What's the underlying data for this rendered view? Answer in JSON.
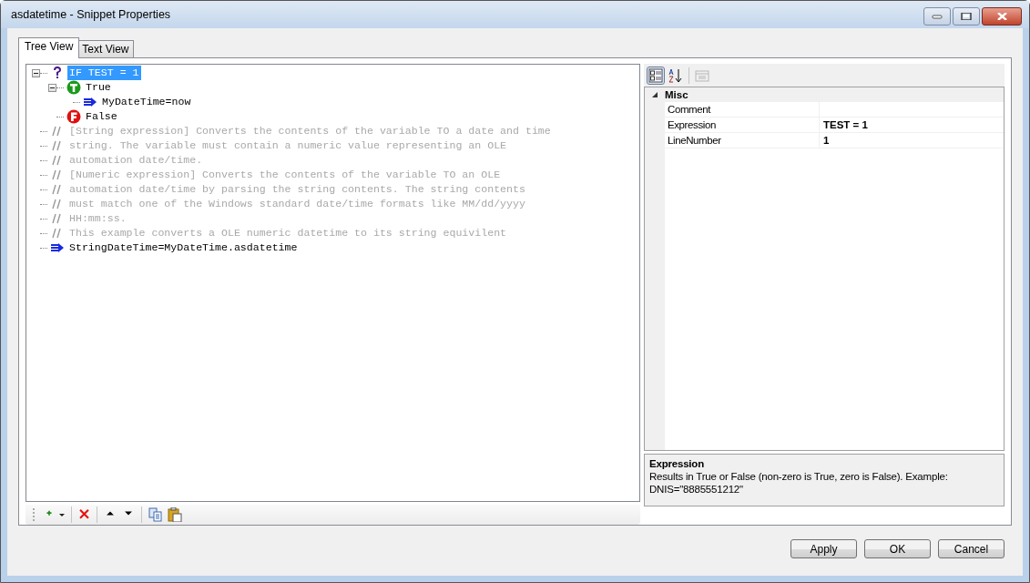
{
  "window": {
    "title": "asdatetime - Snippet Properties"
  },
  "tabs": [
    {
      "label": "Tree View",
      "selected": true
    },
    {
      "label": "Text View",
      "selected": false
    }
  ],
  "tree": [
    {
      "kind": "if",
      "text": "IF TEST = 1",
      "selected": true,
      "expanded": true,
      "children": [
        {
          "kind": "true",
          "text": "True",
          "selected": false,
          "expanded": true,
          "children": [
            {
              "kind": "statement",
              "text": "MyDateTime=now",
              "selected": false
            }
          ]
        },
        {
          "kind": "false",
          "text": "False",
          "selected": false
        }
      ]
    },
    {
      "kind": "comment",
      "text": "[String expression] Converts the contents of the variable TO a date and time",
      "selected": false
    },
    {
      "kind": "comment",
      "text": "string. The variable must contain a numeric value representing an OLE",
      "selected": false
    },
    {
      "kind": "comment",
      "text": "automation date/time.",
      "selected": false
    },
    {
      "kind": "comment",
      "text": "[Numeric expression] Converts the contents of the variable TO an OLE",
      "selected": false
    },
    {
      "kind": "comment",
      "text": "automation date/time by parsing the string contents. The string contents",
      "selected": false
    },
    {
      "kind": "comment",
      "text": "must match one of the Windows standard date/time formats like MM/dd/yyyy",
      "selected": false
    },
    {
      "kind": "comment",
      "text": "HH:mm:ss.",
      "selected": false
    },
    {
      "kind": "comment",
      "text": "This example converts a OLE numeric datetime to its string equivilent",
      "selected": false
    },
    {
      "kind": "statement",
      "text": "StringDateTime=MyDateTime.asdatetime",
      "selected": false
    }
  ],
  "grid_toolbar": [
    {
      "kind": "categorized",
      "selected": true,
      "disabled": false
    },
    {
      "kind": "alphabetical",
      "selected": false,
      "disabled": false
    },
    {
      "kind": "pages",
      "selected": false,
      "disabled": true
    }
  ],
  "properties": {
    "category": "Misc",
    "expanded": true,
    "rows": [
      {
        "name": "Comment",
        "value": ""
      },
      {
        "name": "Expression",
        "value": "TEST = 1"
      },
      {
        "name": "LineNumber",
        "value": "1"
      }
    ]
  },
  "description": {
    "title": "Expression",
    "text": "Results in True or False (non-zero is True, zero is False). Example: DNIS=\"8885551212\""
  },
  "buttons": [
    "Apply",
    "OK",
    "Cancel"
  ]
}
